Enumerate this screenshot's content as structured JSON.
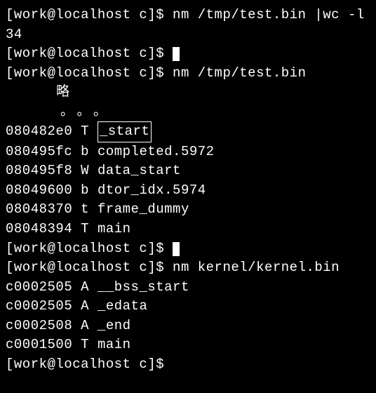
{
  "prompt": "[work@localhost c]$ ",
  "cmd1": "nm /tmp/test.bin |wc -l",
  "output1": "34",
  "cmd2": "nm /tmp/test.bin",
  "omitted": "略",
  "dots": "。。。",
  "nm_test": [
    {
      "addr": "080482e0",
      "type": "T",
      "sym": "_start",
      "boxed": true
    },
    {
      "addr": "080495fc",
      "type": "b",
      "sym": "completed.5972"
    },
    {
      "addr": "080495f8",
      "type": "W",
      "sym": "data_start"
    },
    {
      "addr": "08049600",
      "type": "b",
      "sym": "dtor_idx.5974"
    },
    {
      "addr": "08048370",
      "type": "t",
      "sym": "frame_dummy"
    },
    {
      "addr": "08048394",
      "type": "T",
      "sym": "main"
    }
  ],
  "cmd3": "nm kernel/kernel.bin",
  "nm_kernel": [
    {
      "addr": "c0002505",
      "type": "A",
      "sym": "__bss_start"
    },
    {
      "addr": "c0002505",
      "type": "A",
      "sym": "_edata"
    },
    {
      "addr": "c0002508",
      "type": "A",
      "sym": "_end"
    },
    {
      "addr": "c0001500",
      "type": "T",
      "sym": "main"
    }
  ]
}
